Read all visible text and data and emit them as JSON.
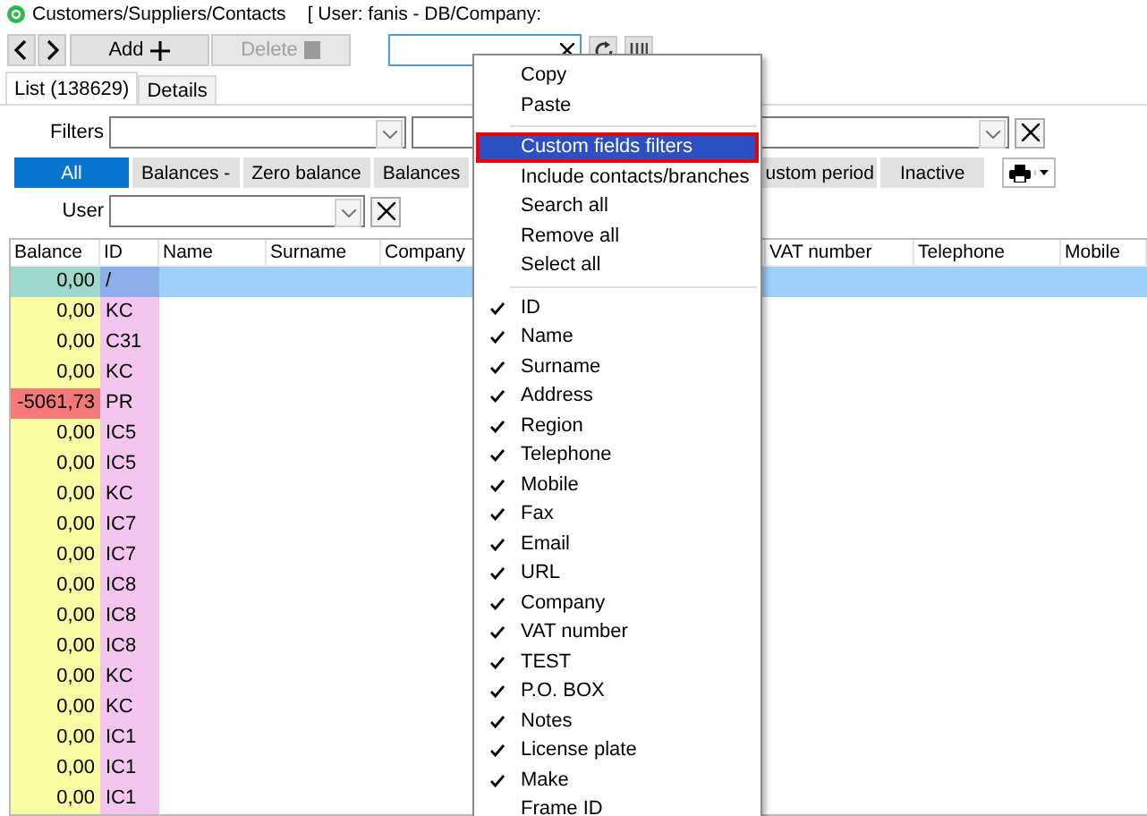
{
  "window": {
    "title": "Customers/Suppliers/Contacts",
    "user_info": "[ User: fanis - DB/Company:"
  },
  "toolbar": {
    "add_label": "Add",
    "delete_label": "Delete",
    "delete_disabled": true
  },
  "tabs": [
    {
      "label": "List (138629)",
      "selected": true
    },
    {
      "label": "Details",
      "selected": false
    }
  ],
  "filters": {
    "label": "Filters"
  },
  "filter_buttons": [
    {
      "label": "All",
      "selected": true
    },
    {
      "label": "Balances -",
      "selected": false
    },
    {
      "label": "Zero balance",
      "selected": false
    },
    {
      "label": "Balances",
      "selected": false
    },
    {
      "label": "ustom period",
      "selected": false
    },
    {
      "label": "Inactive",
      "selected": false
    }
  ],
  "user_filter": {
    "label": "User"
  },
  "table": {
    "columns": [
      "Balance",
      "ID",
      "Name",
      "Surname",
      "Company",
      "",
      "VAT number",
      "Telephone",
      "Mobile"
    ],
    "rows": [
      {
        "balance": "0,00",
        "id": "/",
        "color": "#9ed8cc",
        "selected": true
      },
      {
        "balance": "0,00",
        "id": "KC",
        "color": "#fbfba4",
        "selected": false
      },
      {
        "balance": "0,00",
        "id": "C31",
        "color": "#fbfba4",
        "selected": false
      },
      {
        "balance": "0,00",
        "id": "KC",
        "color": "#fbfba4",
        "selected": false
      },
      {
        "balance": "-5061,73",
        "id": "PR",
        "color": "#f47a7a",
        "selected": false
      },
      {
        "balance": "0,00",
        "id": "IC5",
        "color": "#fbfba4",
        "selected": false
      },
      {
        "balance": "0,00",
        "id": "IC5",
        "color": "#fbfba4",
        "selected": false
      },
      {
        "balance": "0,00",
        "id": "KC",
        "color": "#fbfba4",
        "selected": false
      },
      {
        "balance": "0,00",
        "id": "IC7",
        "color": "#fbfba4",
        "selected": false
      },
      {
        "balance": "0,00",
        "id": "IC7",
        "color": "#fbfba4",
        "selected": false
      },
      {
        "balance": "0,00",
        "id": "IC8",
        "color": "#fbfba4",
        "selected": false
      },
      {
        "balance": "0,00",
        "id": "IC8",
        "color": "#fbfba4",
        "selected": false
      },
      {
        "balance": "0,00",
        "id": "IC8",
        "color": "#fbfba4",
        "selected": false
      },
      {
        "balance": "0,00",
        "id": "KC",
        "color": "#fbfba4",
        "selected": false
      },
      {
        "balance": "0,00",
        "id": "KC",
        "color": "#fbfba4",
        "selected": false
      },
      {
        "balance": "0,00",
        "id": "IC1",
        "color": "#fbfba4",
        "selected": false
      },
      {
        "balance": "0,00",
        "id": "IC1",
        "color": "#fbfba4",
        "selected": false
      },
      {
        "balance": "0,00",
        "id": "IC1",
        "color": "#fbfba4",
        "selected": false
      }
    ]
  },
  "context_menu": {
    "actions": [
      {
        "label": "Copy",
        "selected": false
      },
      {
        "label": "Paste",
        "selected": false
      },
      {
        "label": "Custom fields filters",
        "selected": true
      },
      {
        "label": "Include contacts/branches",
        "selected": false
      },
      {
        "label": "Search all",
        "selected": false
      },
      {
        "label": "Remove all",
        "selected": false
      },
      {
        "label": "Select all",
        "selected": false
      }
    ],
    "columns": [
      {
        "label": "ID",
        "checked": true
      },
      {
        "label": "Name",
        "checked": true
      },
      {
        "label": "Surname",
        "checked": true
      },
      {
        "label": "Address",
        "checked": true
      },
      {
        "label": "Region",
        "checked": true
      },
      {
        "label": "Telephone",
        "checked": true
      },
      {
        "label": "Mobile",
        "checked": true
      },
      {
        "label": "Fax",
        "checked": true
      },
      {
        "label": "Email",
        "checked": true
      },
      {
        "label": "URL",
        "checked": true
      },
      {
        "label": "Company",
        "checked": true
      },
      {
        "label": "VAT number",
        "checked": true
      },
      {
        "label": "TEST",
        "checked": true
      },
      {
        "label": "P.O. BOX",
        "checked": true
      },
      {
        "label": "Notes",
        "checked": true
      },
      {
        "label": "License plate",
        "checked": true
      },
      {
        "label": "Make",
        "checked": true
      },
      {
        "label": "Frame ID",
        "checked": false
      }
    ]
  }
}
